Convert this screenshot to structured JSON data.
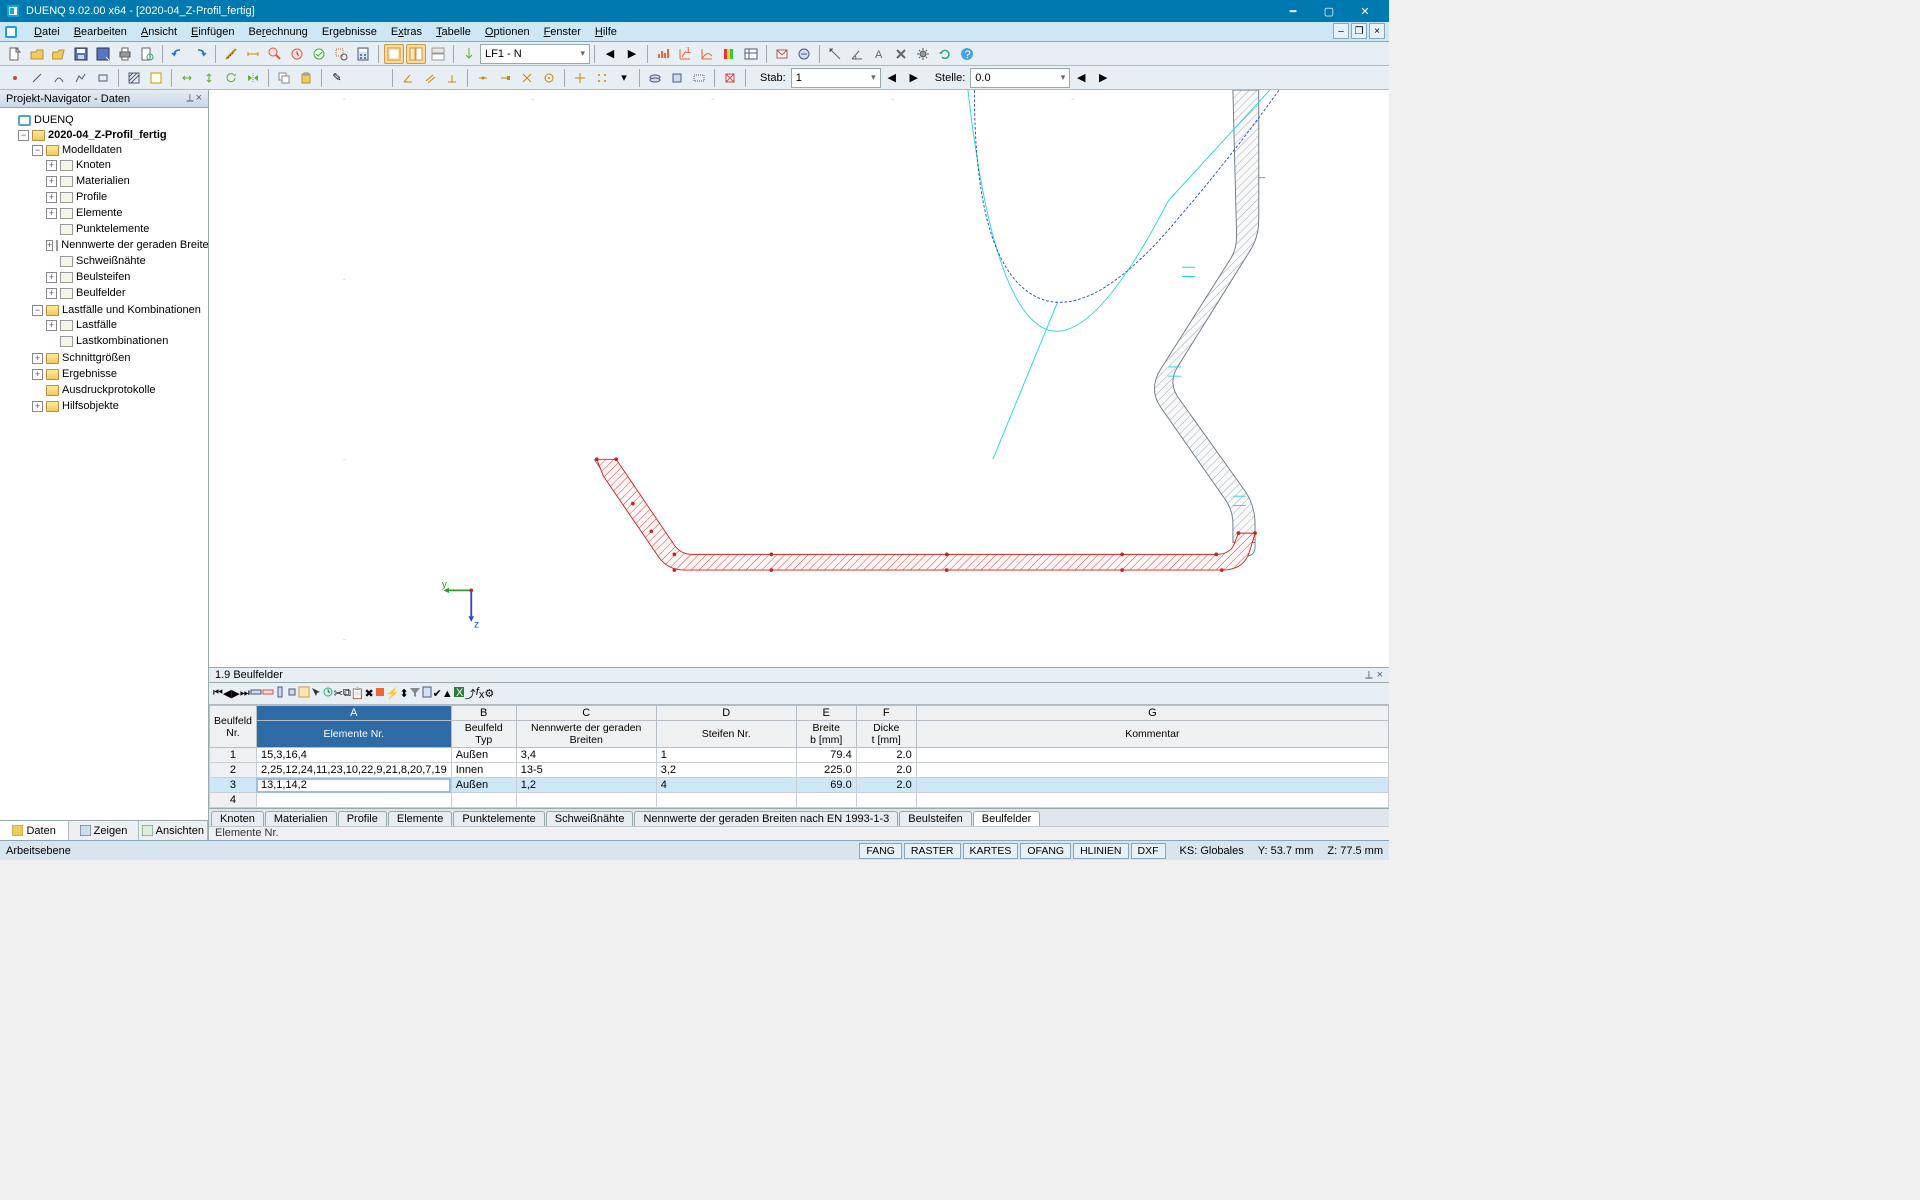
{
  "title": "DUENQ 9.02.00 x64 - [2020-04_Z-Profil_fertig]",
  "menu": [
    "Datei",
    "Bearbeiten",
    "Ansicht",
    "Einfügen",
    "Berechnung",
    "Ergebnisse",
    "Extras",
    "Tabelle",
    "Optionen",
    "Fenster",
    "Hilfe"
  ],
  "toolbar1": {
    "combo": "LF1 - N",
    "stab_label": "Stab:",
    "stab_val": "1",
    "stelle_label": "Stelle:",
    "stelle_val": "0.0"
  },
  "navigator": {
    "title": "Projekt-Navigator - Daten",
    "root": "DUENQ",
    "model": "2020-04_Z-Profil_fertig",
    "md": {
      "label": "Modelldaten",
      "items": [
        "Knoten",
        "Materialien",
        "Profile",
        "Elemente",
        "Punktelemente",
        "Nennwerte der geraden Breiten",
        "Schweißnähte",
        "Beulsteifen",
        "Beulfelder"
      ]
    },
    "lf": {
      "label": "Lastfälle und Kombinationen",
      "items": [
        "Lastfälle",
        "Lastkombinationen"
      ]
    },
    "rest": [
      "Schnittgrößen",
      "Ergebnisse",
      "Ausdruckprotokolle",
      "Hilfsobjekte"
    ]
  },
  "nav_tabs": [
    "Daten",
    "Zeigen",
    "Ansichten"
  ],
  "panel": {
    "title": "1.9 Beulfelder",
    "cols": [
      "A",
      "B",
      "C",
      "D",
      "E",
      "F",
      "G"
    ],
    "hdr1": {
      "beulfeld": "Beulfeld",
      "nr": "Nr.",
      "elem": "Elemente Nr.",
      "btyp": "Beulfeld",
      "typ": "Typ",
      "nenn": "Nennwerte der geraden Breiten",
      "steifen": "Steifen Nr.",
      "breite": "Breite",
      "bmm": "b [mm]",
      "dicke": "Dicke",
      "tmm": "t [mm]",
      "komm": "Kommentar"
    },
    "rows": [
      {
        "no": "1",
        "elem": "15,3,16,4",
        "typ": "Außen",
        "nenn": "3,4",
        "steifen": "1",
        "b": "79.4",
        "t": "2.0",
        "k": ""
      },
      {
        "no": "2",
        "elem": "2,25,12,24,11,23,10,22,9,21,8,20,7,19",
        "typ": "Innen",
        "nenn": "13-5",
        "steifen": "3,2",
        "b": "225.0",
        "t": "2.0",
        "k": ""
      },
      {
        "no": "3",
        "elem": "13,1,14,2",
        "typ": "Außen",
        "nenn": "1,2",
        "steifen": "4",
        "b": "69.0",
        "t": "2.0",
        "k": ""
      },
      {
        "no": "4",
        "elem": "",
        "typ": "",
        "nenn": "",
        "steifen": "",
        "b": "",
        "t": "",
        "k": ""
      }
    ],
    "tabs": [
      "Knoten",
      "Materialien",
      "Profile",
      "Elemente",
      "Punktelemente",
      "Schweißnähte",
      "Nennwerte der geraden Breiten nach EN 1993-1-3",
      "Beulsteifen",
      "Beulfelder"
    ],
    "status": "Elemente Nr."
  },
  "status": {
    "left": "Arbeitsebene",
    "boxes": [
      "FANG",
      "RASTER",
      "KARTES",
      "OFANG",
      "HLINIEN",
      "DXF"
    ],
    "ks": "KS: Globales",
    "y": "Y:  53.7 mm",
    "z": "Z:  77.5 mm"
  }
}
